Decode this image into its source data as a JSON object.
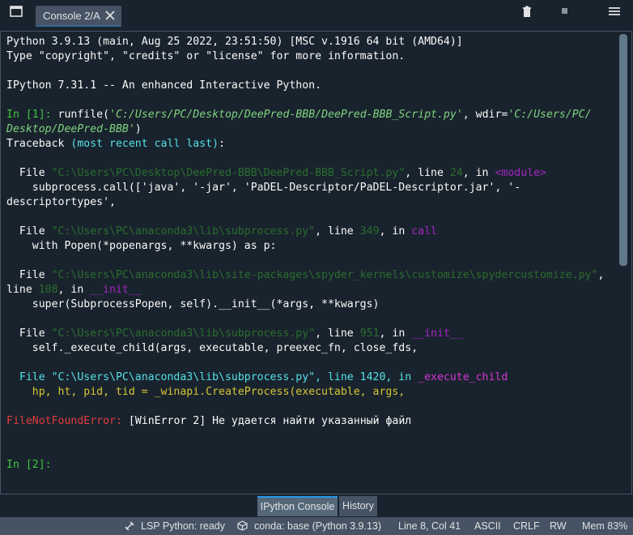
{
  "tab": {
    "label": "Console 2/A"
  },
  "console": {
    "lines": [
      [
        {
          "t": "Python 3.9.13 (main, Aug 25 2022, 23:51:50) [MSC v.1916 64 bit (AMD64)]",
          "c": ""
        }
      ],
      [
        {
          "t": "Type \"copyright\", \"credits\" or \"license\" for more information.",
          "c": ""
        }
      ],
      [],
      [
        {
          "t": "IPython 7.31.1 -- An enhanced Interactive Python.",
          "c": ""
        }
      ],
      [],
      [
        {
          "t": "In [",
          "c": "c-green"
        },
        {
          "t": "1",
          "c": "c-green"
        },
        {
          "t": "]: ",
          "c": "c-green"
        },
        {
          "t": "runfile(",
          "c": ""
        },
        {
          "t": "'C:/Users/PC/Desktop/DeePred-BBB/DeePred-BBB_Script.py'",
          "c": "c-greenit"
        },
        {
          "t": ", wdir=",
          "c": ""
        },
        {
          "t": "'C:/Users/PC/",
          "c": "c-greenit"
        }
      ],
      [
        {
          "t": "Desktop/DeePred-BBB'",
          "c": "c-greenit"
        },
        {
          "t": ")",
          "c": ""
        }
      ],
      [
        {
          "t": "Traceback ",
          "c": ""
        },
        {
          "t": "(most recent call last)",
          "c": "c-cyan"
        },
        {
          "t": ":",
          "c": ""
        }
      ],
      [],
      [
        {
          "t": "  File ",
          "c": ""
        },
        {
          "t": "\"C:\\Users\\PC\\Desktop\\DeePred-BBB\\DeePred-BBB_Script.py\"",
          "c": "c-dimline"
        },
        {
          "t": ", line ",
          "c": ""
        },
        {
          "t": "24",
          "c": "c-dimline"
        },
        {
          "t": ", in ",
          "c": ""
        },
        {
          "t": "<module>",
          "c": "c-purple"
        }
      ],
      [
        {
          "t": "    subprocess.call(['java', '-jar', 'PaDEL-Descriptor/PaDEL-Descriptor.jar', '-",
          "c": ""
        }
      ],
      [
        {
          "t": "descriptortypes',",
          "c": ""
        }
      ],
      [],
      [
        {
          "t": "  File ",
          "c": ""
        },
        {
          "t": "\"C:\\Users\\PC\\anaconda3\\lib\\subprocess.py\"",
          "c": "c-dimline"
        },
        {
          "t": ", line ",
          "c": ""
        },
        {
          "t": "349",
          "c": "c-dimline"
        },
        {
          "t": ", in ",
          "c": ""
        },
        {
          "t": "call",
          "c": "c-purple"
        }
      ],
      [
        {
          "t": "    with Popen(*popenargs, **kwargs) as p:",
          "c": ""
        }
      ],
      [],
      [
        {
          "t": "  File ",
          "c": ""
        },
        {
          "t": "\"C:\\Users\\PC\\anaconda3\\lib\\site-packages\\spyder_kernels\\customize\\spydercustomize.py\"",
          "c": "c-dimline"
        },
        {
          "t": ",",
          "c": ""
        }
      ],
      [
        {
          "t": "line ",
          "c": ""
        },
        {
          "t": "108",
          "c": "c-dimline"
        },
        {
          "t": ", in ",
          "c": ""
        },
        {
          "t": "__init__",
          "c": "c-purple"
        }
      ],
      [
        {
          "t": "    super(SubprocessPopen, self).__init__(*args, **kwargs)",
          "c": ""
        }
      ],
      [],
      [
        {
          "t": "  File ",
          "c": ""
        },
        {
          "t": "\"C:\\Users\\PC\\anaconda3\\lib\\subprocess.py\"",
          "c": "c-dimline"
        },
        {
          "t": ", line ",
          "c": ""
        },
        {
          "t": "951",
          "c": "c-dimline"
        },
        {
          "t": ", in ",
          "c": ""
        },
        {
          "t": "__init__",
          "c": "c-purple"
        }
      ],
      [
        {
          "t": "    self._execute_child(args, executable, preexec_fn, close_fds,",
          "c": ""
        }
      ],
      [],
      [
        {
          "t": "  File \"C:\\Users\\PC\\anaconda3\\lib\\subprocess.py\", line 1420, in ",
          "c": "c-cyan"
        },
        {
          "t": "_execute_child",
          "c": "c-magenta"
        }
      ],
      [
        {
          "t": "    hp, ht, pid, tid = _winapi.CreateProcess(executable, args,",
          "c": "c-yellow"
        }
      ],
      [],
      [
        {
          "t": "FileNotFoundError",
          "c": "c-red"
        },
        {
          "t": ": ",
          "c": "c-red"
        },
        {
          "t": "[WinError 2] Не удается найти указанный файл",
          "c": ""
        }
      ],
      [],
      [],
      [
        {
          "t": "In [",
          "c": "c-green"
        },
        {
          "t": "2",
          "c": "c-green"
        },
        {
          "t": "]:",
          "c": "c-green"
        }
      ]
    ]
  },
  "bottom_tabs": [
    {
      "label": "IPython Console",
      "active": true
    },
    {
      "label": "History",
      "active": false
    }
  ],
  "status": {
    "lsp": "LSP Python: ready",
    "conda": "conda: base (Python 3.9.13)",
    "position": "Line 8, Col 41",
    "encoding": "ASCII",
    "eol": "CRLF",
    "permissions": "RW",
    "memory": "Mem 83%"
  },
  "icons": [
    "pane-toggle-icon",
    "close-icon",
    "trash-icon",
    "stop-icon",
    "menu-icon",
    "lsp-icon",
    "conda-icon"
  ]
}
